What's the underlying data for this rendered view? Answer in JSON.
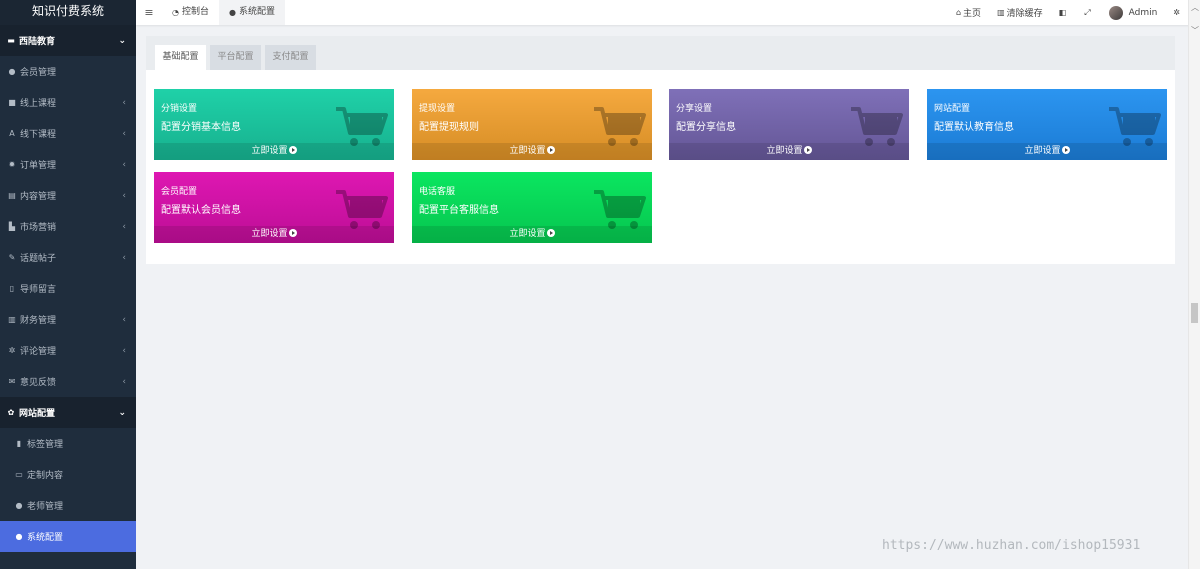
{
  "app": {
    "title": "知识付费系统"
  },
  "sidebar": {
    "items": [
      {
        "label": "西陆教育",
        "icon": "folder-icon",
        "glyph": "▬",
        "type": "group",
        "arrow": "⌄"
      },
      {
        "label": "会员管理",
        "icon": "user-icon",
        "glyph": "●",
        "type": "item",
        "arrow": ""
      },
      {
        "label": "线上课程",
        "icon": "book-icon",
        "glyph": "■",
        "type": "item",
        "arrow": "‹"
      },
      {
        "label": "线下课程",
        "icon": "font-icon",
        "glyph": "A",
        "type": "item",
        "arrow": "‹"
      },
      {
        "label": "订单管理",
        "icon": "gear-icon",
        "glyph": "✹",
        "type": "item",
        "arrow": "‹"
      },
      {
        "label": "内容管理",
        "icon": "list-icon",
        "glyph": "▤",
        "type": "item",
        "arrow": "‹"
      },
      {
        "label": "市场营销",
        "icon": "bar-chart-icon",
        "glyph": "▙",
        "type": "item",
        "arrow": "‹"
      },
      {
        "label": "话题帖子",
        "icon": "edit-icon",
        "glyph": "✎",
        "type": "item",
        "arrow": "‹"
      },
      {
        "label": "导师留言",
        "icon": "file-icon",
        "glyph": "▯",
        "type": "item",
        "arrow": ""
      },
      {
        "label": "财务管理",
        "icon": "bank-icon",
        "glyph": "▥",
        "type": "item",
        "arrow": "‹"
      },
      {
        "label": "评论管理",
        "icon": "settings-icon",
        "glyph": "✲",
        "type": "item",
        "arrow": "‹"
      },
      {
        "label": "意见反馈",
        "icon": "envelope-icon",
        "glyph": "✉",
        "type": "item",
        "arrow": "‹"
      },
      {
        "label": "网站配置",
        "icon": "gear-icon",
        "glyph": "✿",
        "type": "group",
        "arrow": "⌄"
      },
      {
        "label": "标签管理",
        "icon": "bookmark-icon",
        "glyph": "▮",
        "type": "sub",
        "arrow": ""
      },
      {
        "label": "定制内容",
        "icon": "folder-open-icon",
        "glyph": "▭",
        "type": "sub",
        "arrow": ""
      },
      {
        "label": "老师管理",
        "icon": "user-plus-icon",
        "glyph": "●",
        "type": "sub",
        "arrow": ""
      },
      {
        "label": "系统配置",
        "icon": "user-plus-icon",
        "glyph": "●",
        "type": "sub active",
        "arrow": ""
      }
    ]
  },
  "topbar": {
    "menu_glyph": "≡",
    "tabs": [
      {
        "label": "控制台",
        "icon": "dashboard-icon",
        "glyph": "◔"
      },
      {
        "label": "系统配置",
        "icon": "user-plus-icon",
        "glyph": "●"
      }
    ],
    "right": [
      {
        "label": "主页",
        "icon": "home-icon",
        "glyph": "⌂"
      },
      {
        "label": "清除缓存",
        "icon": "trash-icon",
        "glyph": "▥"
      },
      {
        "label": "",
        "icon": "translate-icon",
        "glyph": "◧"
      },
      {
        "label": "",
        "icon": "fullscreen-icon",
        "glyph": "⤢"
      }
    ],
    "user": "Admin",
    "settings_glyph": "✲"
  },
  "config_tabs": [
    "基础配置",
    "平台配置",
    "支付配置"
  ],
  "cards": [
    {
      "title": "分销设置",
      "desc": "配置分销基本信息",
      "action": "立即设置",
      "color": "#1fd1a8",
      "dark": "#17b08e"
    },
    {
      "title": "提现设置",
      "desc": "配置提现规则",
      "action": "立即设置",
      "color": "#f5a93f",
      "dark": "#d68d25"
    },
    {
      "title": "分享设置",
      "desc": "配置分享信息",
      "action": "立即设置",
      "color": "#7f70b8",
      "dark": "#645696"
    },
    {
      "title": "网站配置",
      "desc": "配置默认教育信息",
      "action": "立即设置",
      "color": "#2c95f0",
      "dark": "#1b7bd4"
    },
    {
      "title": "会员配置",
      "desc": "配置默认会员信息",
      "action": "立即设置",
      "color": "#de17b2",
      "dark": "#bd0e96"
    },
    {
      "title": "电话客服",
      "desc": "配置平台客服信息",
      "action": "立即设置",
      "color": "#0be660",
      "dark": "#06c54f"
    }
  ],
  "watermark": "https://www.huzhan.com/ishop15931"
}
